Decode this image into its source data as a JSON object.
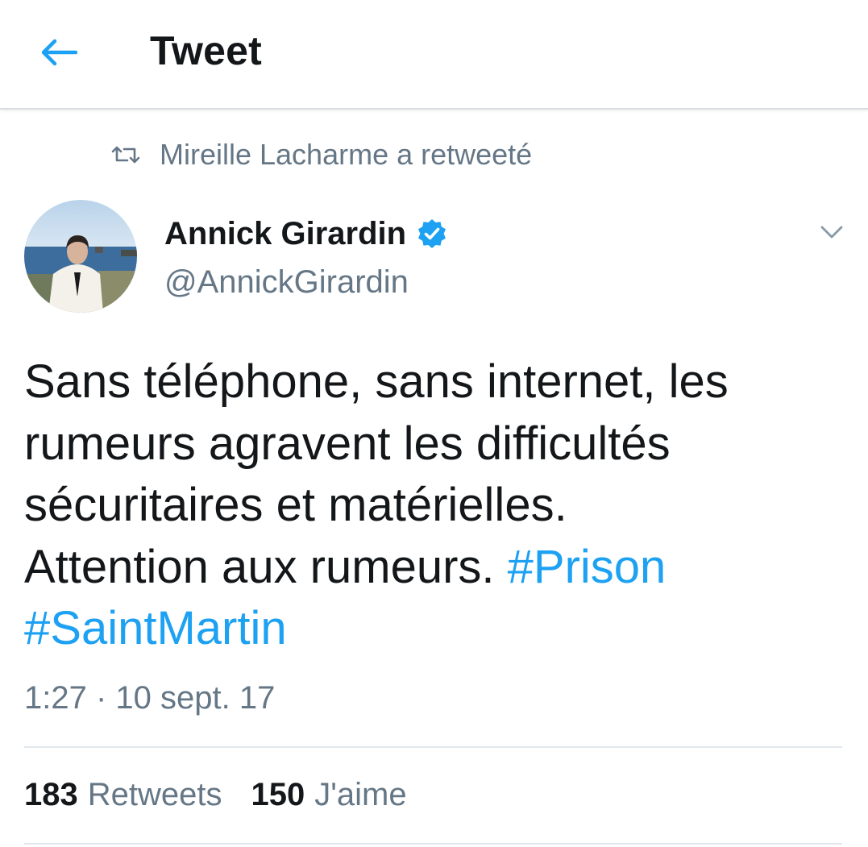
{
  "header": {
    "title": "Tweet",
    "back_icon": "arrow-left-icon",
    "accent": "#1da1f2"
  },
  "retweet_context": {
    "icon": "retweet-icon",
    "text": "Mireille Lacharme a retweeté"
  },
  "tweet": {
    "author": {
      "name": "Annick Girardin",
      "handle": "@AnnickGirardin",
      "verified": true
    },
    "text_lines": [
      "Sans téléphone, sans internet, les",
      "rumeurs agravent les difficultés",
      "sécuritaires et matérielles.",
      "Attention aux rumeurs."
    ],
    "hashtags": [
      "#Prison",
      "#SaintMartin"
    ],
    "timestamp": "1:27 · 10 sept. 17",
    "stats": {
      "retweets_count": "183",
      "retweets_label": "Retweets",
      "likes_count": "150",
      "likes_label": "J'aime"
    }
  },
  "colors": {
    "text_primary": "#14171a",
    "text_secondary": "#657786",
    "link": "#1da1f2",
    "verified": "#1da1f2",
    "divider": "#e1e8ed"
  }
}
